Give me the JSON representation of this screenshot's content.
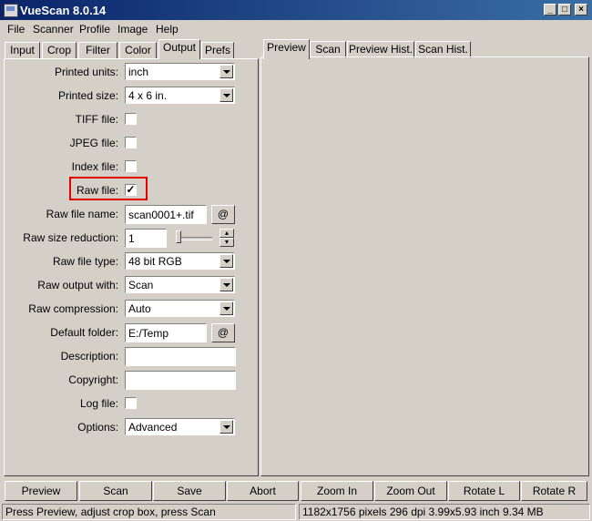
{
  "window": {
    "title": "VueScan 8.0.14"
  },
  "menu": [
    "File",
    "Scanner",
    "Profile",
    "Image",
    "Help"
  ],
  "left_tabs": [
    "Input",
    "Crop",
    "Filter",
    "Color",
    "Output",
    "Prefs"
  ],
  "right_tabs": [
    "Preview",
    "Scan",
    "Preview Hist.",
    "Scan Hist."
  ],
  "output": {
    "printed_units": {
      "label": "Printed units:",
      "value": "inch"
    },
    "printed_size": {
      "label": "Printed size:",
      "value": "4 x 6 in."
    },
    "tiff_file": {
      "label": "TIFF file:"
    },
    "jpeg_file": {
      "label": "JPEG file:"
    },
    "index_file": {
      "label": "Index file:"
    },
    "raw_file": {
      "label": "Raw file:",
      "checked": true
    },
    "raw_file_name": {
      "label": "Raw file name:",
      "value": "scan0001+.tif",
      "at": "@"
    },
    "raw_size_reduction": {
      "label": "Raw size reduction:",
      "value": "1"
    },
    "raw_file_type": {
      "label": "Raw file type:",
      "value": "48 bit RGB"
    },
    "raw_output_with": {
      "label": "Raw output with:",
      "value": "Scan"
    },
    "raw_compression": {
      "label": "Raw compression:",
      "value": "Auto"
    },
    "default_folder": {
      "label": "Default folder:",
      "value": "E:/Temp",
      "at": "@"
    },
    "description": {
      "label": "Description:",
      "value": ""
    },
    "copyright": {
      "label": "Copyright:",
      "value": ""
    },
    "log_file": {
      "label": "Log file:"
    },
    "options": {
      "label": "Options:",
      "value": "Advanced"
    }
  },
  "buttons": [
    "Preview",
    "Scan",
    "Save",
    "Abort",
    "Zoom In",
    "Zoom Out",
    "Rotate L",
    "Rotate R"
  ],
  "status": {
    "left": "Press Preview, adjust crop box, press Scan",
    "right": "1182x1756 pixels 296 dpi 3.99x5.93 inch 9.34 MB"
  },
  "colors": {
    "titlebar": "#0a246a",
    "face": "#d4d0c8",
    "highlight": "#e00000"
  },
  "icons": [
    "app-icon",
    "minimize-icon",
    "maximize-icon",
    "close-icon",
    "check-icon",
    "dropdown-arrow-icon",
    "slider-icon",
    "spin-icon"
  ]
}
